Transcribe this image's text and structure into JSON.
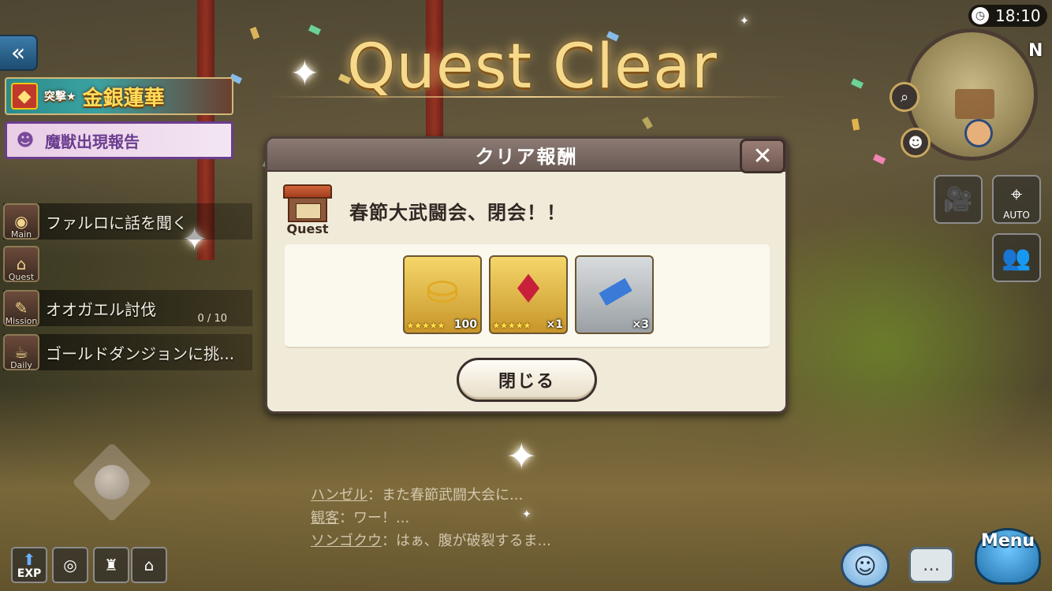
{
  "scene": {
    "title": "Quest Clear",
    "time": "18:10",
    "compass": "N"
  },
  "left_panel": {
    "back_icon": "double-chevron-left-icon",
    "event_banner": "金銀蓮華",
    "event_badge": "突撃★",
    "report_banner": "魔獣出現報告",
    "tasks": [
      {
        "category": "Main",
        "label": "ファルロに話を聞く",
        "progress": "",
        "icon": "clock-icon"
      },
      {
        "category": "Quest",
        "label": "",
        "progress": "",
        "icon": "quest-house-icon"
      },
      {
        "category": "Mission",
        "label": "オオガエル討伐",
        "progress": "0 / 10",
        "icon": "mission-icon"
      },
      {
        "category": "Daily",
        "label": "ゴールドダンジョンに挑...",
        "progress": "",
        "icon": "daily-icon"
      }
    ]
  },
  "dialog": {
    "title": "クリア報酬",
    "close_icon": "close-icon",
    "quest_badge": "Quest",
    "quest_name": "春節大武闘会、閉会！！",
    "rewards": [
      {
        "name": "gold-ingot",
        "stars": "★★★★★",
        "count": "100",
        "bg": "gold"
      },
      {
        "name": "red-crystal",
        "stars": "★★★★★",
        "count": "×1",
        "bg": "gold"
      },
      {
        "name": "blue-ticket",
        "stars": "",
        "count": "×3",
        "bg": "silver"
      }
    ],
    "close_button": "閉じる"
  },
  "hud_right": {
    "camera_icon": "camera-icon",
    "auto_label": "AUTO",
    "party_icon": "party-icon"
  },
  "chat": [
    {
      "speaker": "ハンゼル",
      "text": "：また春節武闘大会に..."
    },
    {
      "speaker": "観客",
      "text": "：ワー！..."
    },
    {
      "speaker": "ソンゴクウ",
      "text": "：はぁ、腹が破裂するま..."
    }
  ],
  "bottom_left": {
    "exp_label": "EXP"
  },
  "bottom_right": {
    "menu_label": "Menu"
  },
  "colors": {
    "title_gold": "#f6d98a",
    "dialog_bg": "#f0ead8",
    "dialog_header": "#7a6a63",
    "star": "#ffe14a"
  }
}
